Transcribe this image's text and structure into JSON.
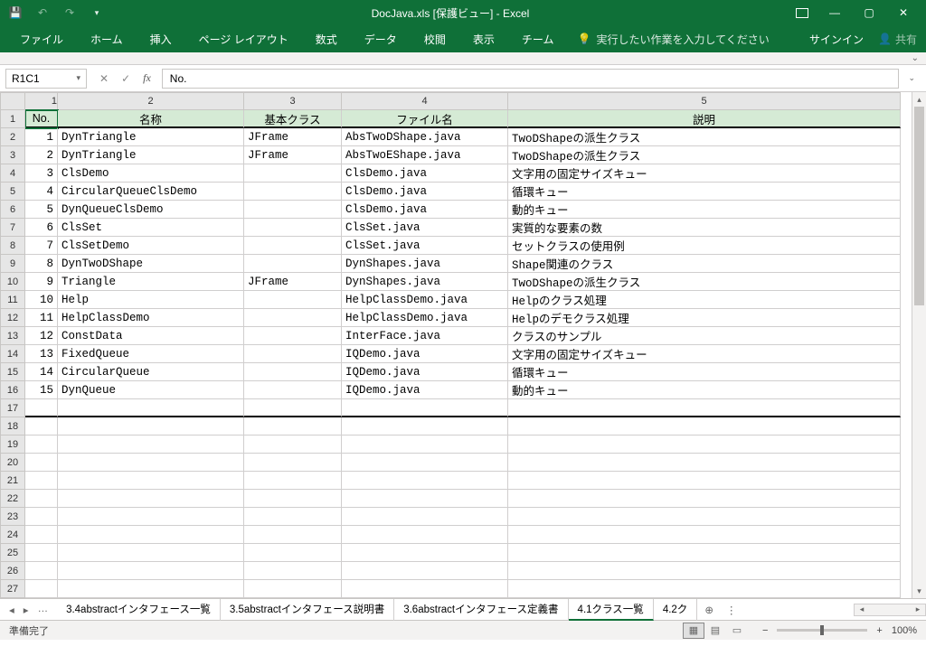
{
  "titlebar": {
    "title": "DocJava.xls  [保護ビュー] - Excel"
  },
  "ribbon": {
    "tabs": [
      "ファイル",
      "ホーム",
      "挿入",
      "ページ レイアウト",
      "数式",
      "データ",
      "校閲",
      "表示",
      "チーム"
    ],
    "tellme": "実行したい作業を入力してください",
    "signin": "サインイン",
    "share": "共有"
  },
  "fx": {
    "name_box": "R1C1",
    "formula": "No."
  },
  "cols": [
    "1",
    "2",
    "3",
    "4",
    "5"
  ],
  "headers": {
    "c1": "No.",
    "c2": "名称",
    "c3": "基本クラス",
    "c4": "ファイル名",
    "c5": "説明"
  },
  "rows": [
    {
      "n": "1",
      "name": "DynTriangle",
      "base": "JFrame",
      "file": "AbsTwoDShape.java",
      "desc": "TwoDShapeの派生クラス"
    },
    {
      "n": "2",
      "name": "DynTriangle",
      "base": "JFrame",
      "file": "AbsTwoEShape.java",
      "desc": "TwoDShapeの派生クラス"
    },
    {
      "n": "3",
      "name": "ClsDemo",
      "base": "",
      "file": "ClsDemo.java",
      "desc": "文字用の固定サイズキュー"
    },
    {
      "n": "4",
      "name": "CircularQueueClsDemo",
      "base": "",
      "file": "ClsDemo.java",
      "desc": "循環キュー"
    },
    {
      "n": "5",
      "name": "DynQueueClsDemo",
      "base": "",
      "file": "ClsDemo.java",
      "desc": "動的キュー"
    },
    {
      "n": "6",
      "name": "ClsSet",
      "base": "",
      "file": "ClsSet.java",
      "desc": "実質的な要素の数"
    },
    {
      "n": "7",
      "name": "ClsSetDemo",
      "base": "",
      "file": "ClsSet.java",
      "desc": "セットクラスの使用例"
    },
    {
      "n": "8",
      "name": "DynTwoDShape",
      "base": "",
      "file": "DynShapes.java",
      "desc": "Shape関連のクラス"
    },
    {
      "n": "9",
      "name": "Triangle",
      "base": "JFrame",
      "file": "DynShapes.java",
      "desc": "TwoDShapeの派生クラス"
    },
    {
      "n": "10",
      "name": "Help",
      "base": "",
      "file": "HelpClassDemo.java",
      "desc": "Helpのクラス処理"
    },
    {
      "n": "11",
      "name": "HelpClassDemo",
      "base": "",
      "file": "HelpClassDemo.java",
      "desc": "Helpのデモクラス処理"
    },
    {
      "n": "12",
      "name": "ConstData",
      "base": "",
      "file": "InterFace.java",
      "desc": "クラスのサンプル"
    },
    {
      "n": "13",
      "name": "FixedQueue",
      "base": "",
      "file": "IQDemo.java",
      "desc": "文字用の固定サイズキュー"
    },
    {
      "n": "14",
      "name": "CircularQueue",
      "base": "",
      "file": "IQDemo.java",
      "desc": "循環キュー"
    },
    {
      "n": "15",
      "name": "DynQueue",
      "base": "",
      "file": "IQDemo.java",
      "desc": "動的キュー"
    }
  ],
  "sheets": {
    "tabs": [
      "3.4abstractインタフェース一覧",
      "3.5abstractインタフェース説明書",
      "3.6abstractインタフェース定義書",
      "4.1クラス一覧",
      "4.2ク"
    ],
    "active": 3
  },
  "status": {
    "ready": "準備完了",
    "zoom": "100%"
  }
}
